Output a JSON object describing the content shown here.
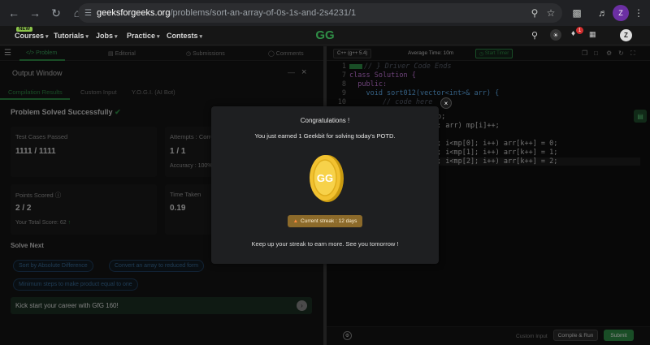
{
  "browser": {
    "url_host": "geeksforgeeks.org",
    "url_path": "/problems/sort-an-array-of-0s-1s-and-2s4231/1",
    "profile_initial": "Z"
  },
  "gfgnav": {
    "items": [
      "Courses",
      "Tutorials",
      "Jobs",
      "Practice",
      "Contests"
    ],
    "new_badge": "NEW",
    "logo": "GG",
    "notif_count": "1",
    "user_initial": "Z"
  },
  "problem_tabs": [
    "Problem",
    "Editorial",
    "Submissions",
    "Comments"
  ],
  "output": {
    "title": "Output Window",
    "subtabs": [
      "Compilation Results",
      "Custom Input",
      "Y.O.G.I. (AI Bot)"
    ],
    "status": "Problem Solved Successfully",
    "test_cases_label": "Test Cases Passed",
    "test_cases_value": "1111 / 1111",
    "attempts_label": "Attempts : Corre",
    "attempts_value": "1 / 1",
    "accuracy": "Accuracy : 100%",
    "points_label": "Points Scored",
    "points_value": "2 / 2",
    "total_score": "Your Total Score: 62",
    "time_label": "Time Taken",
    "time_value": "0.19",
    "solve_next": "Solve Next",
    "suggestions": [
      "Sort by Absolute Difference",
      "Convert an array to reduced form",
      "Minimum steps to make product equal to one"
    ],
    "career": "Kick start your career with GfG 160!"
  },
  "editor": {
    "language": "C++ (g++ 5.4)",
    "avg_time": "Average Time: 10m",
    "timer": "Start Timer",
    "lines": [
      {
        "n": "1",
        "text": "// } Driver Code Ends"
      },
      {
        "n": "7",
        "text": "class Solution {"
      },
      {
        "n": "8",
        "text": "  public:"
      },
      {
        "n": "9",
        "text": "    void sort012(vector<int>& arr) {"
      },
      {
        "n": "10",
        "text": "        // code here"
      }
    ],
    "frag1": "p;",
    "frag2": ": arr) mp[i]++;",
    "frag3": "; i<mp[0]; i++) arr[k++] = 0;",
    "frag4": "; i<mp[1]; i++) arr[k++] = 1;",
    "frag5": "; i<mp[2]; i++) arr[k++] = 2;",
    "custom_input": "Custom Input",
    "compile": "Compile & Run",
    "submit": "Submit"
  },
  "modal": {
    "title": "Congratulations !",
    "message": "You just earned 1 Geekbit for solving today's POTD.",
    "streak": "Current streak : 12 days",
    "footer": "Keep up your streak to earn more. See you tomorrow !"
  }
}
